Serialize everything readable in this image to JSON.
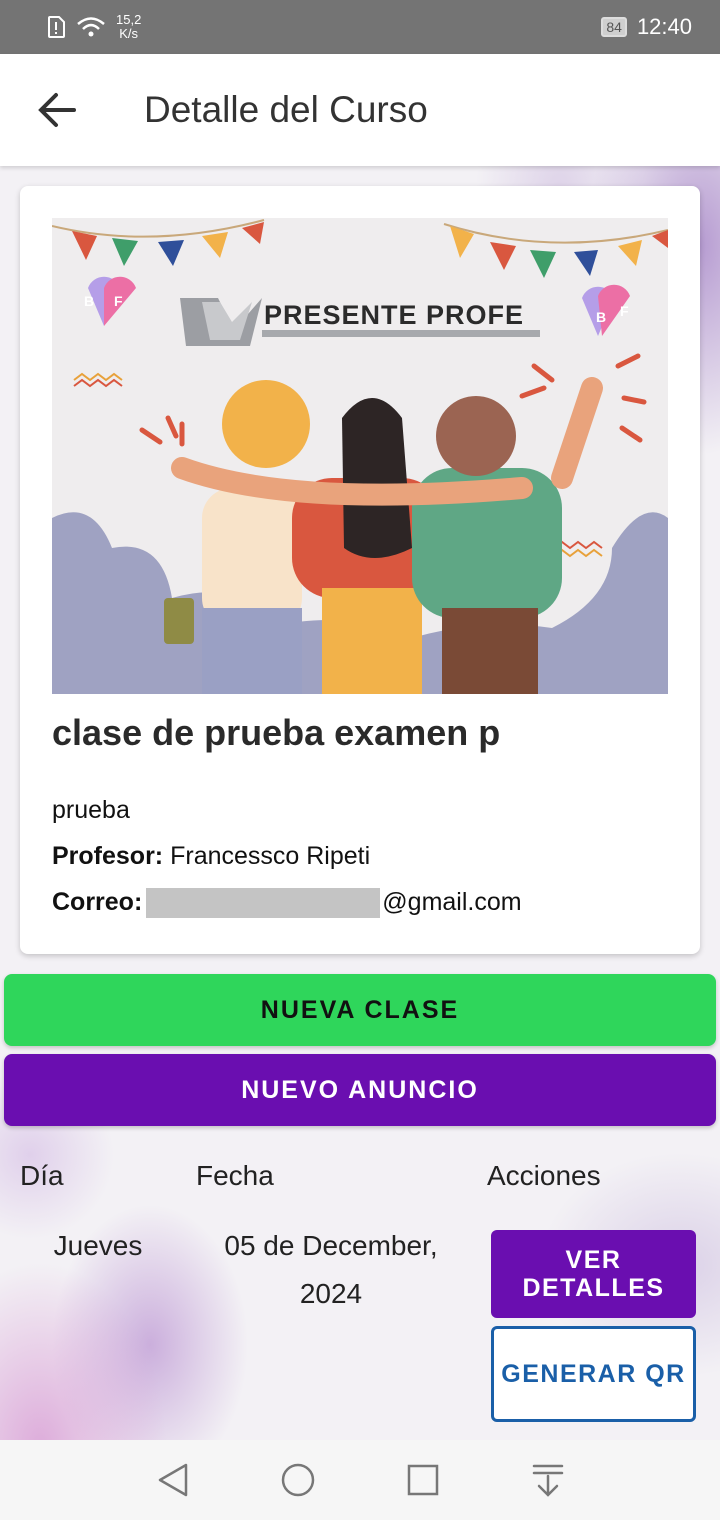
{
  "status_bar": {
    "speed_value": "15,2",
    "speed_unit": "K/s",
    "battery": "84",
    "time": "12:40"
  },
  "app_bar": {
    "title": "Detalle del Curso",
    "back_icon": "arrow-left-icon"
  },
  "course": {
    "banner_text": "PRESENTE PROFE",
    "banner_badge": [
      "B",
      "F"
    ],
    "title": "clase de prueba examen p",
    "description": "prueba",
    "professor_label": "Profesor:",
    "professor_name": "Francessco Ripeti",
    "email_label": "Correo:",
    "email_suffix": "@gmail.com"
  },
  "actions": {
    "new_class": "NUEVA CLASE",
    "new_announcement": "NUEVO ANUNCIO"
  },
  "table": {
    "headers": [
      "Día",
      "Fecha",
      "Acciones"
    ],
    "rows": [
      {
        "day": "Jueves",
        "date_line1": "05 de December,",
        "date_line2": "2024",
        "view_details": "VER DETALLES",
        "generate_qr": "GENERAR QR"
      }
    ]
  },
  "colors": {
    "green_button": "#2fd65b",
    "purple_button": "#6a0eb0",
    "qr_button_border": "#1a5fa8"
  }
}
